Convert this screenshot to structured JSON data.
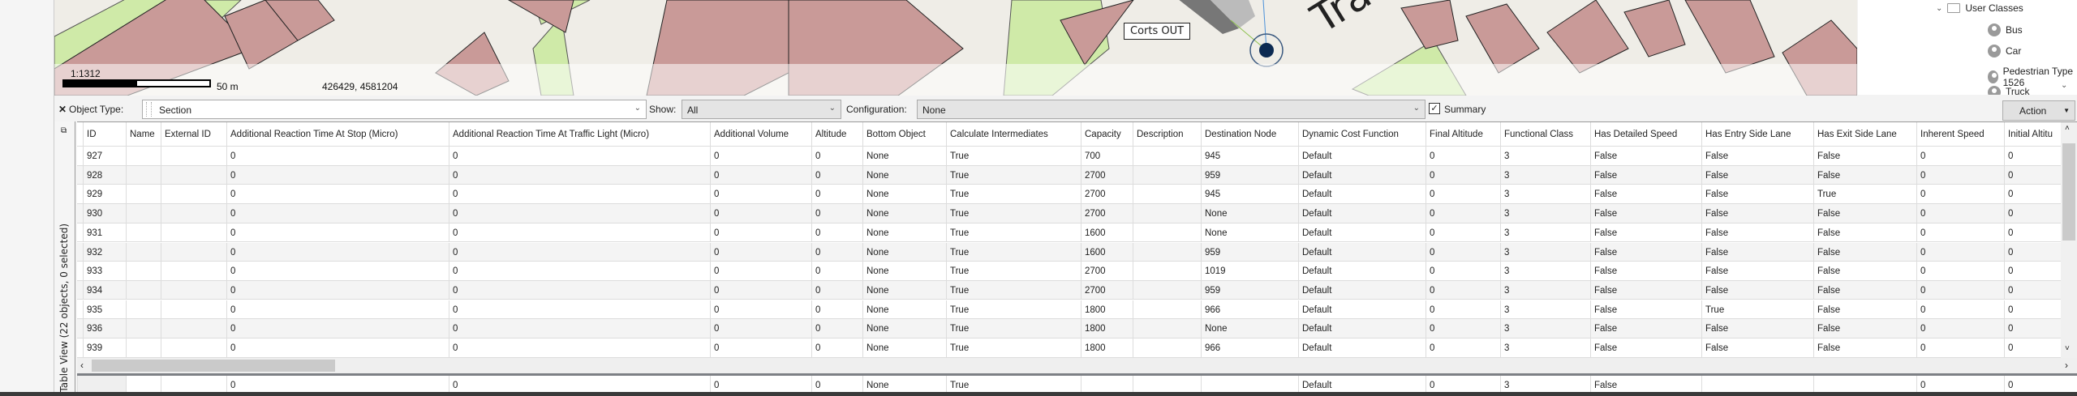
{
  "map": {
    "scale": "1:1312",
    "scale_length": "50 m",
    "coordinates": "426429, 4581204",
    "node_label": "Corts OUT",
    "street_label": "Trave",
    "colors": {
      "building": "#c99a98",
      "park": "#cfeaa8",
      "ground": "#efede7",
      "node": "#0c2a52"
    }
  },
  "tree": {
    "folder": "User Classes",
    "items": [
      "Bus",
      "Car",
      "Pedestrian Type 1526",
      "Truck"
    ]
  },
  "toolbar": {
    "close": "✕",
    "object_type_label": "Object Type:",
    "object_type_value": "Section",
    "show_label": "Show:",
    "show_value": "All",
    "configuration_label": "Configuration:",
    "configuration_value": "None",
    "summary_label": "Summary",
    "summary_checked": true,
    "action_label": "Action"
  },
  "table_view": {
    "title": "Table View (22 objects, 0 selected)",
    "columns": [
      "ID",
      "Name",
      "External ID",
      "Additional Reaction Time At Stop (Micro)",
      "Additional Reaction Time At Traffic Light (Micro)",
      "Additional Volume",
      "Altitude",
      "Bottom Object",
      "Calculate Intermediates",
      "Capacity",
      "Description",
      "Destination Node",
      "Dynamic Cost Function",
      "Final Altitude",
      "Functional Class",
      "Has Detailed Speed",
      "Has Entry Side Lane",
      "Has Exit Side Lane",
      "Inherent Speed",
      "Initial Altitu"
    ],
    "rows": [
      [
        "927",
        "",
        "",
        "0",
        "0",
        "0",
        "0",
        "None",
        "True",
        "700",
        "",
        "945",
        "Default",
        "0",
        "3",
        "False",
        "False",
        "False",
        "0",
        "0"
      ],
      [
        "928",
        "",
        "",
        "0",
        "0",
        "0",
        "0",
        "None",
        "True",
        "2700",
        "",
        "959",
        "Default",
        "0",
        "3",
        "False",
        "False",
        "False",
        "0",
        "0"
      ],
      [
        "929",
        "",
        "",
        "0",
        "0",
        "0",
        "0",
        "None",
        "True",
        "2700",
        "",
        "945",
        "Default",
        "0",
        "3",
        "False",
        "False",
        "True",
        "0",
        "0"
      ],
      [
        "930",
        "",
        "",
        "0",
        "0",
        "0",
        "0",
        "None",
        "True",
        "2700",
        "",
        "None",
        "Default",
        "0",
        "3",
        "False",
        "False",
        "False",
        "0",
        "0"
      ],
      [
        "931",
        "",
        "",
        "0",
        "0",
        "0",
        "0",
        "None",
        "True",
        "1600",
        "",
        "None",
        "Default",
        "0",
        "3",
        "False",
        "False",
        "False",
        "0",
        "0"
      ],
      [
        "932",
        "",
        "",
        "0",
        "0",
        "0",
        "0",
        "None",
        "True",
        "1600",
        "",
        "959",
        "Default",
        "0",
        "3",
        "False",
        "False",
        "False",
        "0",
        "0"
      ],
      [
        "933",
        "",
        "",
        "0",
        "0",
        "0",
        "0",
        "None",
        "True",
        "2700",
        "",
        "1019",
        "Default",
        "0",
        "3",
        "False",
        "False",
        "False",
        "0",
        "0"
      ],
      [
        "934",
        "",
        "",
        "0",
        "0",
        "0",
        "0",
        "None",
        "True",
        "2700",
        "",
        "959",
        "Default",
        "0",
        "3",
        "False",
        "False",
        "False",
        "0",
        "0"
      ],
      [
        "935",
        "",
        "",
        "0",
        "0",
        "0",
        "0",
        "None",
        "True",
        "1800",
        "",
        "966",
        "Default",
        "0",
        "3",
        "False",
        "True",
        "False",
        "0",
        "0"
      ],
      [
        "936",
        "",
        "",
        "0",
        "0",
        "0",
        "0",
        "None",
        "True",
        "1800",
        "",
        "None",
        "Default",
        "0",
        "3",
        "False",
        "False",
        "False",
        "0",
        "0"
      ],
      [
        "939",
        "",
        "",
        "0",
        "0",
        "0",
        "0",
        "None",
        "True",
        "1800",
        "",
        "966",
        "Default",
        "0",
        "3",
        "False",
        "False",
        "False",
        "0",
        "0"
      ]
    ],
    "summary_row": [
      "",
      "",
      "",
      "0",
      "0",
      "0",
      "0",
      "None",
      "True",
      "",
      "",
      "",
      "Default",
      "0",
      "3",
      "False",
      "",
      "",
      "0",
      "0"
    ]
  }
}
